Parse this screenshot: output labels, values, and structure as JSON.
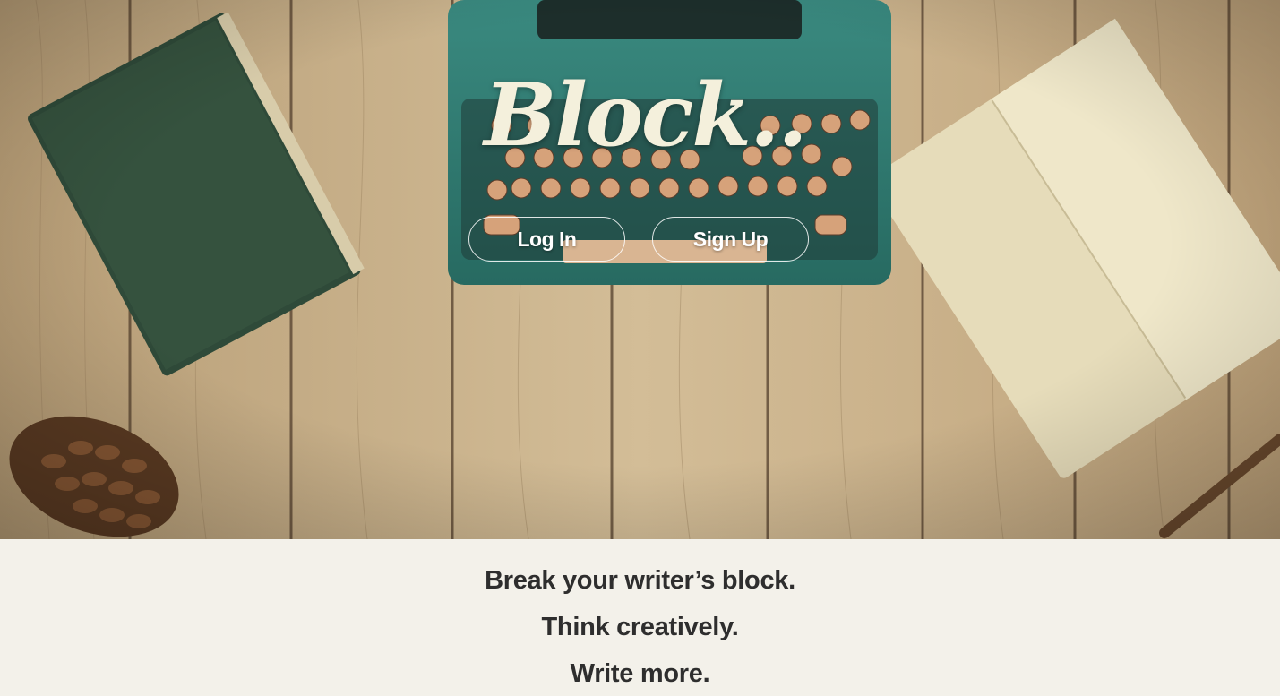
{
  "hero": {
    "logo_text": "Block..",
    "buttons": {
      "login_label": "Log In",
      "signup_label": "Sign Up"
    },
    "background_image": "wooden-desk-with-typewriter-book-notebook-pinecone"
  },
  "taglines": [
    "Break your writer’s block.",
    "Think creatively.",
    "Write more."
  ],
  "colors": {
    "page_background": "#f3f1ea",
    "tagline_text": "#2e2e2e",
    "logo_text": "#f4f0dc",
    "typewriter": "#2f7a70",
    "book": "#34503f",
    "notebook": "#ece4c4",
    "wood": "#c7b08a"
  }
}
